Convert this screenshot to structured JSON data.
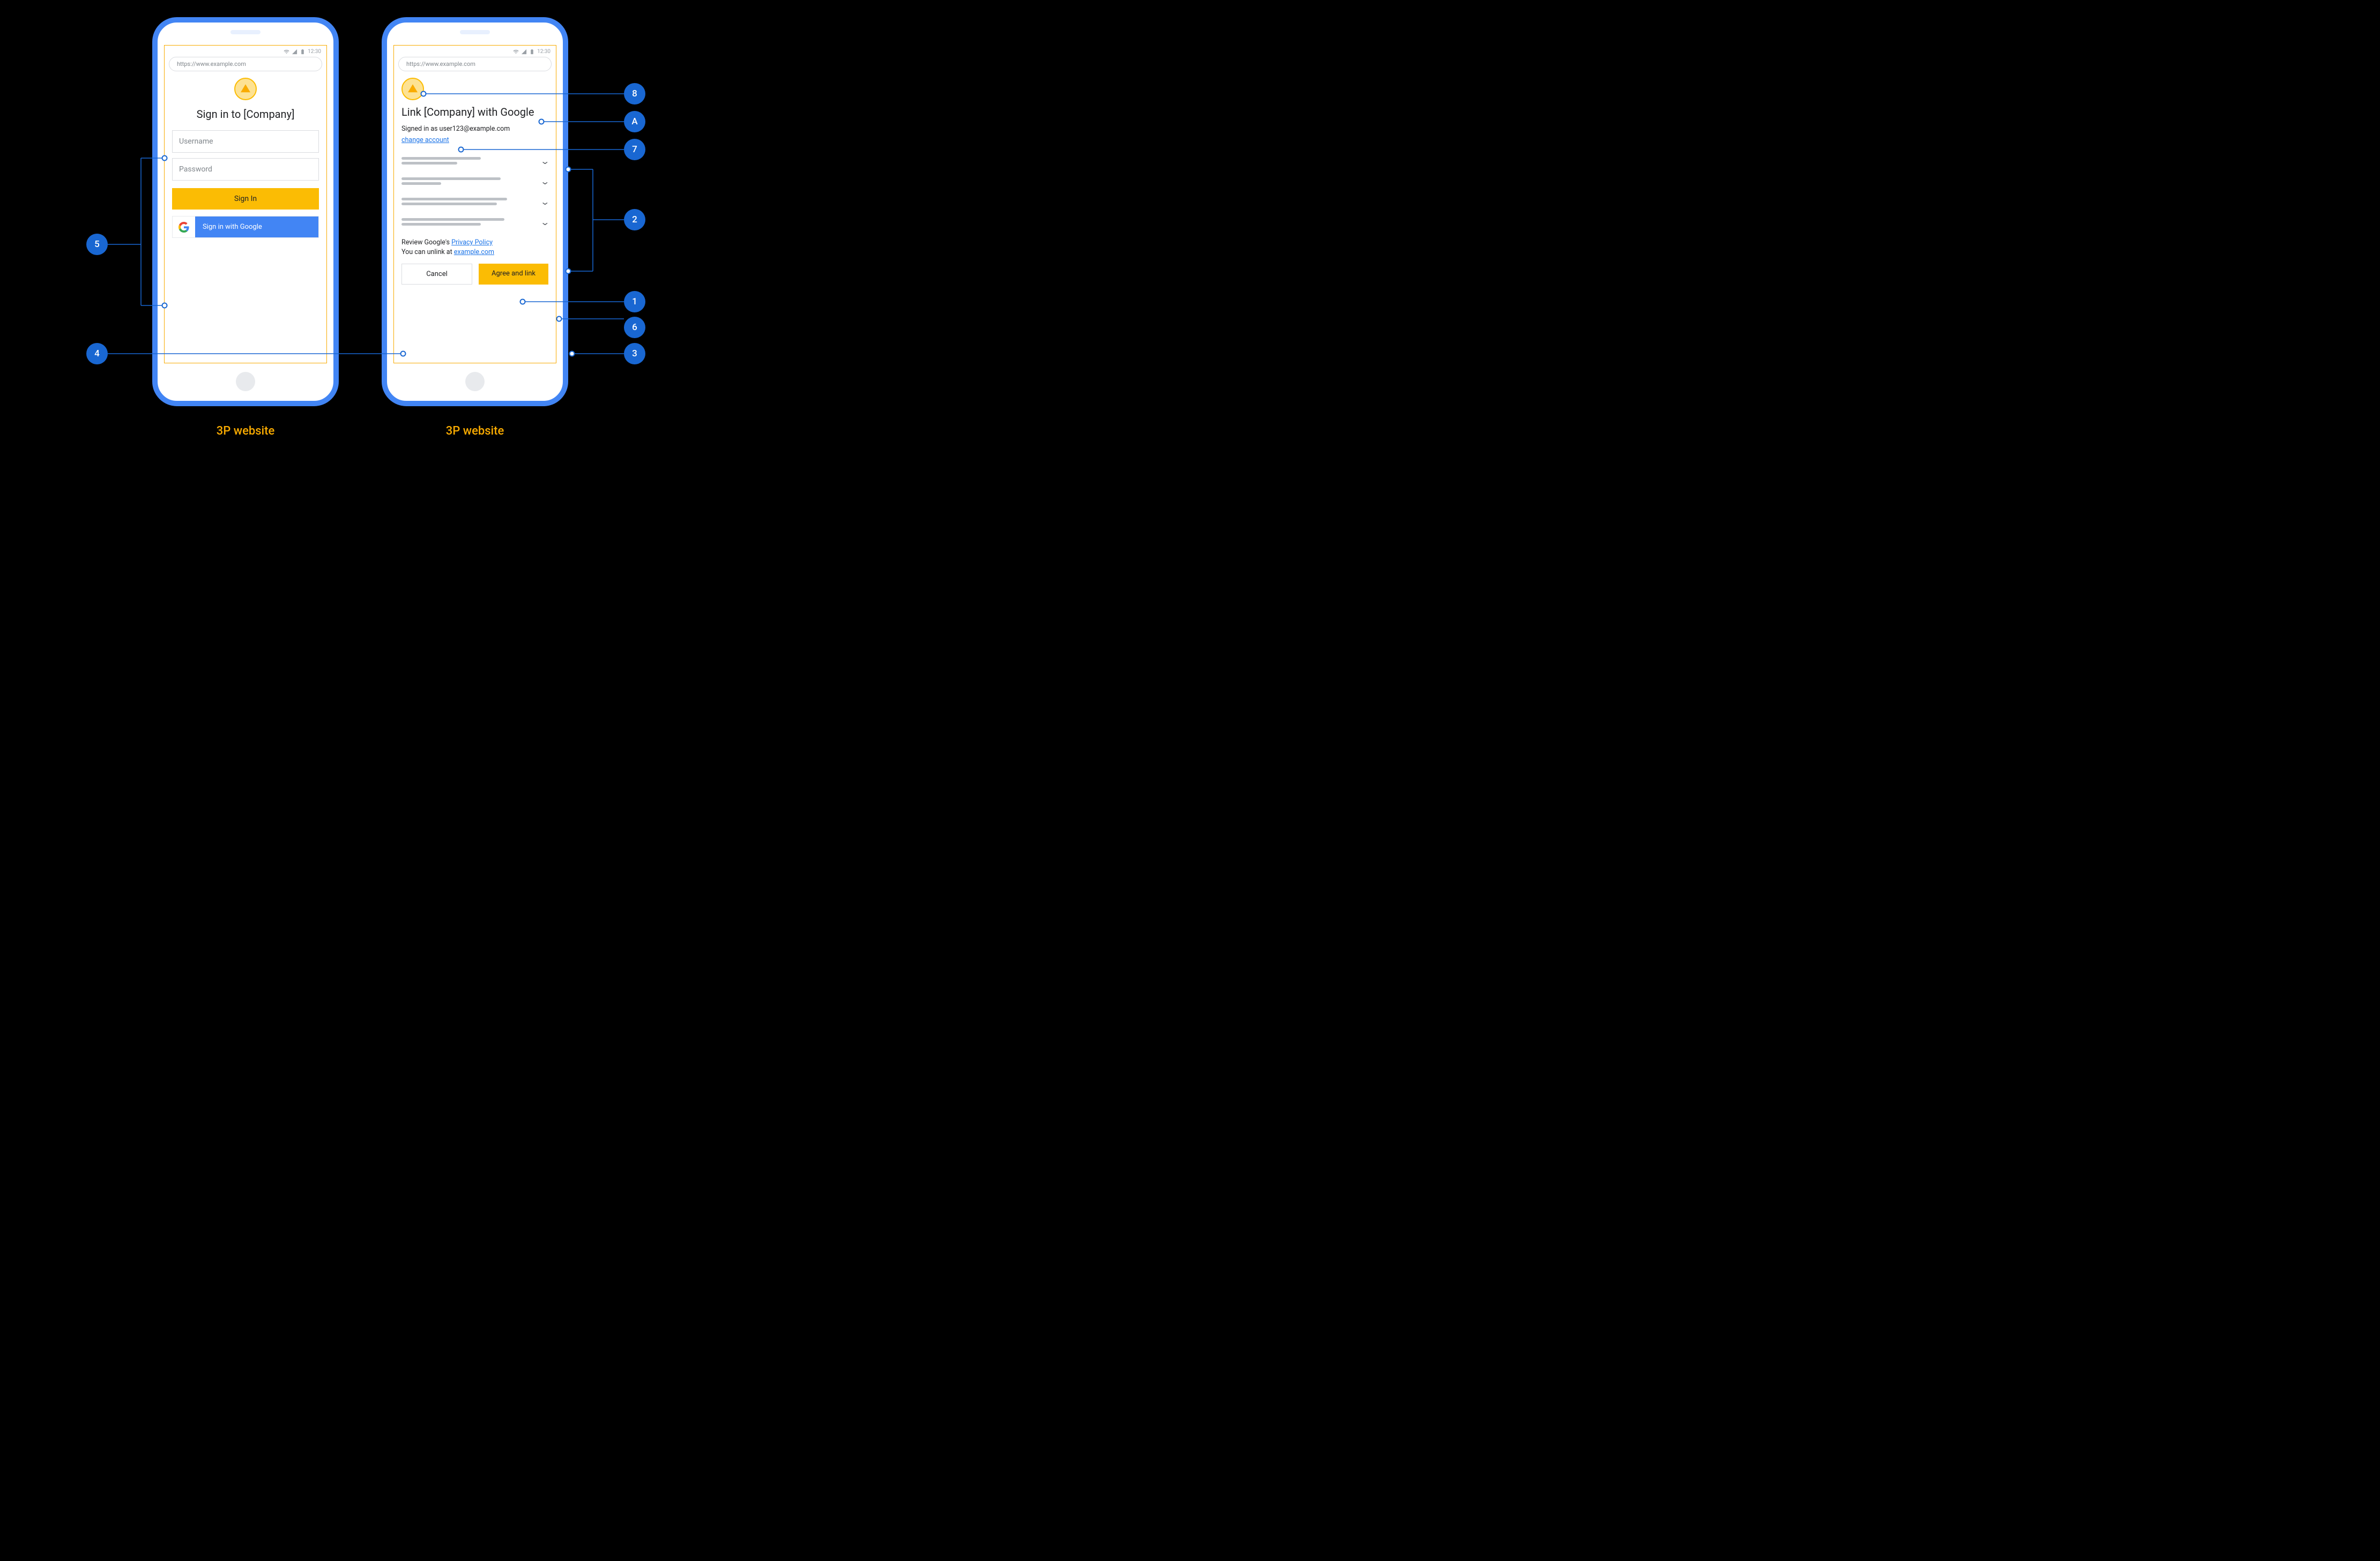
{
  "status": {
    "time": "12:30"
  },
  "url": "https://www.example.com",
  "phone1": {
    "title": "Sign in to [Company]",
    "username_placeholder": "Username",
    "password_placeholder": "Password",
    "signin": "Sign In",
    "google_signin": "Sign in with Google"
  },
  "phone2": {
    "title": "Link [Company] with Google",
    "signed_in_as": "Signed in as user123@example.com",
    "change_account": "change account",
    "review_prefix": "Review Google's ",
    "privacy_policy": "Privacy Policy",
    "unlink_prefix": "You can unlink at ",
    "unlink_link": "example.com",
    "cancel": "Cancel",
    "agree": "Agree and link"
  },
  "captions": {
    "left": "3P website",
    "right": "3P website"
  },
  "annotations": {
    "b5": "5",
    "b4": "4",
    "b8": "8",
    "bA": "A",
    "b7": "7",
    "b2": "2",
    "b1": "1",
    "b6": "6",
    "b3": "3"
  }
}
